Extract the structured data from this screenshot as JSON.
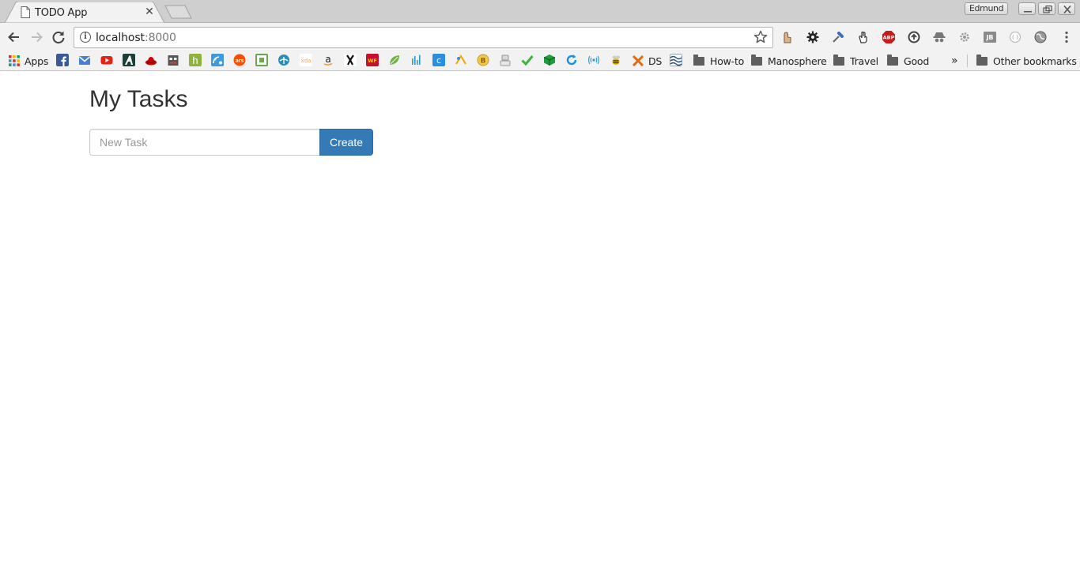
{
  "browser": {
    "tab": {
      "title": "TODO App"
    },
    "profile_name": "Edmund",
    "address": {
      "host": "localhost",
      "port": ":8000"
    },
    "bookmarks": {
      "apps_label": "Apps",
      "ds_label": "DS",
      "folders": [
        "How-to",
        "Manosphere",
        "Travel",
        "Good"
      ],
      "overflow": "»",
      "other_label": "Other bookmarks"
    }
  },
  "page": {
    "heading": "My Tasks",
    "new_task_placeholder": "New Task",
    "create_label": "Create",
    "accent_color": "#337ab7"
  }
}
